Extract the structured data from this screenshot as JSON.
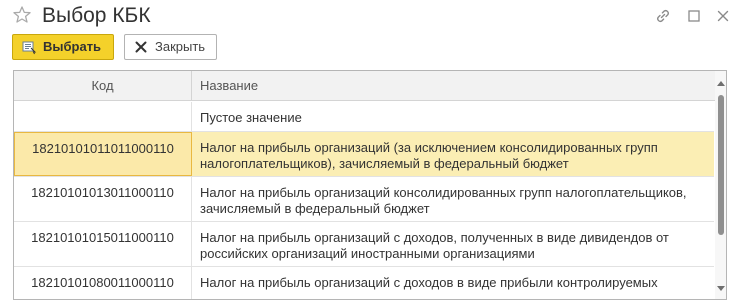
{
  "window": {
    "title": "Выбор КБК"
  },
  "toolbar": {
    "select_label": "Выбрать",
    "close_label": "Закрыть"
  },
  "table": {
    "columns": [
      "Код",
      "Название"
    ],
    "rows": [
      {
        "code": "",
        "name": "Пустое значение"
      },
      {
        "code": "18210101011011000110",
        "name": "Налог на прибыль организаций (за исключением консолидированных групп налогоплательщиков), зачисляемый в федеральный бюджет",
        "selected": true
      },
      {
        "code": "18210101013011000110",
        "name": "Налог на прибыль организаций консолидированных групп налогоплательщиков, зачисляемый в федеральный бюджет"
      },
      {
        "code": "18210101015011000110",
        "name": "Налог на прибыль организаций с доходов, полученных в виде дивидендов от российских организаций иностранными организациями"
      },
      {
        "code": "18210101080011000110",
        "name": "Налог на прибыль организаций с доходов в виде прибыли контролируемых"
      }
    ]
  },
  "colors": {
    "accent_button": "#f4d12a",
    "selected_row": "#fbeeb4"
  },
  "icons": [
    "star-icon",
    "link-icon",
    "maximize-icon",
    "close-icon",
    "select-icon",
    "close-x-icon"
  ]
}
